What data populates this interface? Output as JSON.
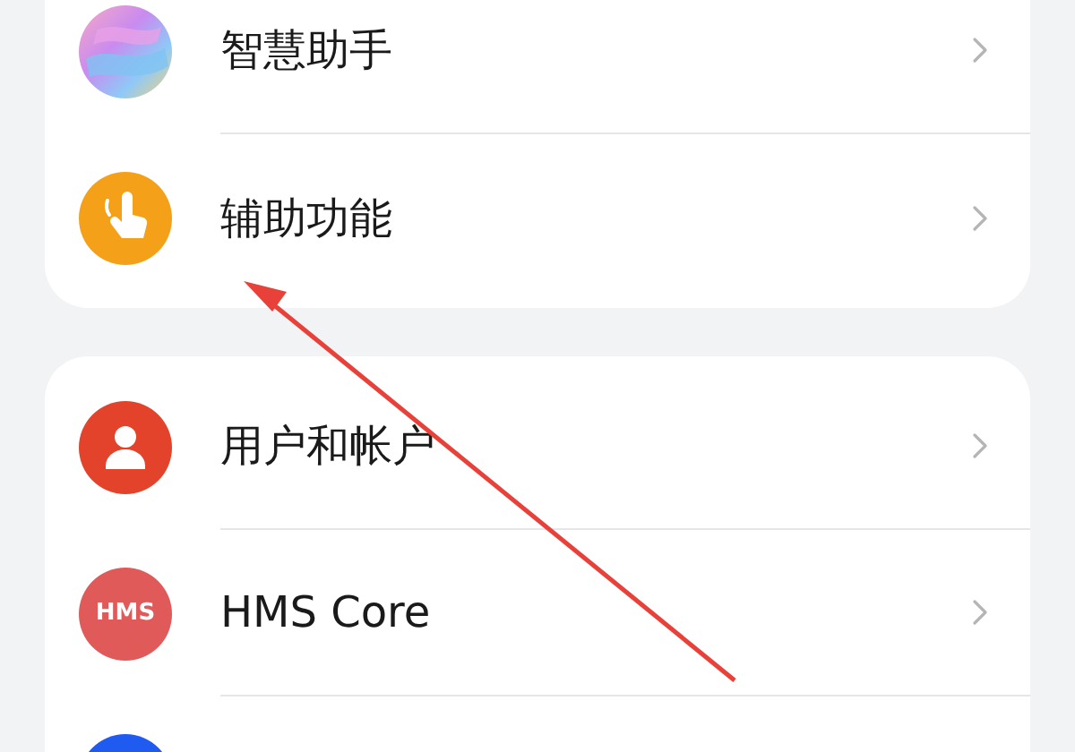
{
  "cards": [
    {
      "items": [
        {
          "kind": "assistant",
          "label": "智慧助手"
        },
        {
          "kind": "accessibility",
          "label": "辅助功能"
        }
      ]
    },
    {
      "items": [
        {
          "kind": "users",
          "label": "用户和帐户"
        },
        {
          "kind": "hms",
          "badge": "HMS",
          "label": "HMS Core"
        },
        {
          "kind": "blue"
        }
      ]
    }
  ],
  "annotation": {
    "kind": "arrow"
  }
}
